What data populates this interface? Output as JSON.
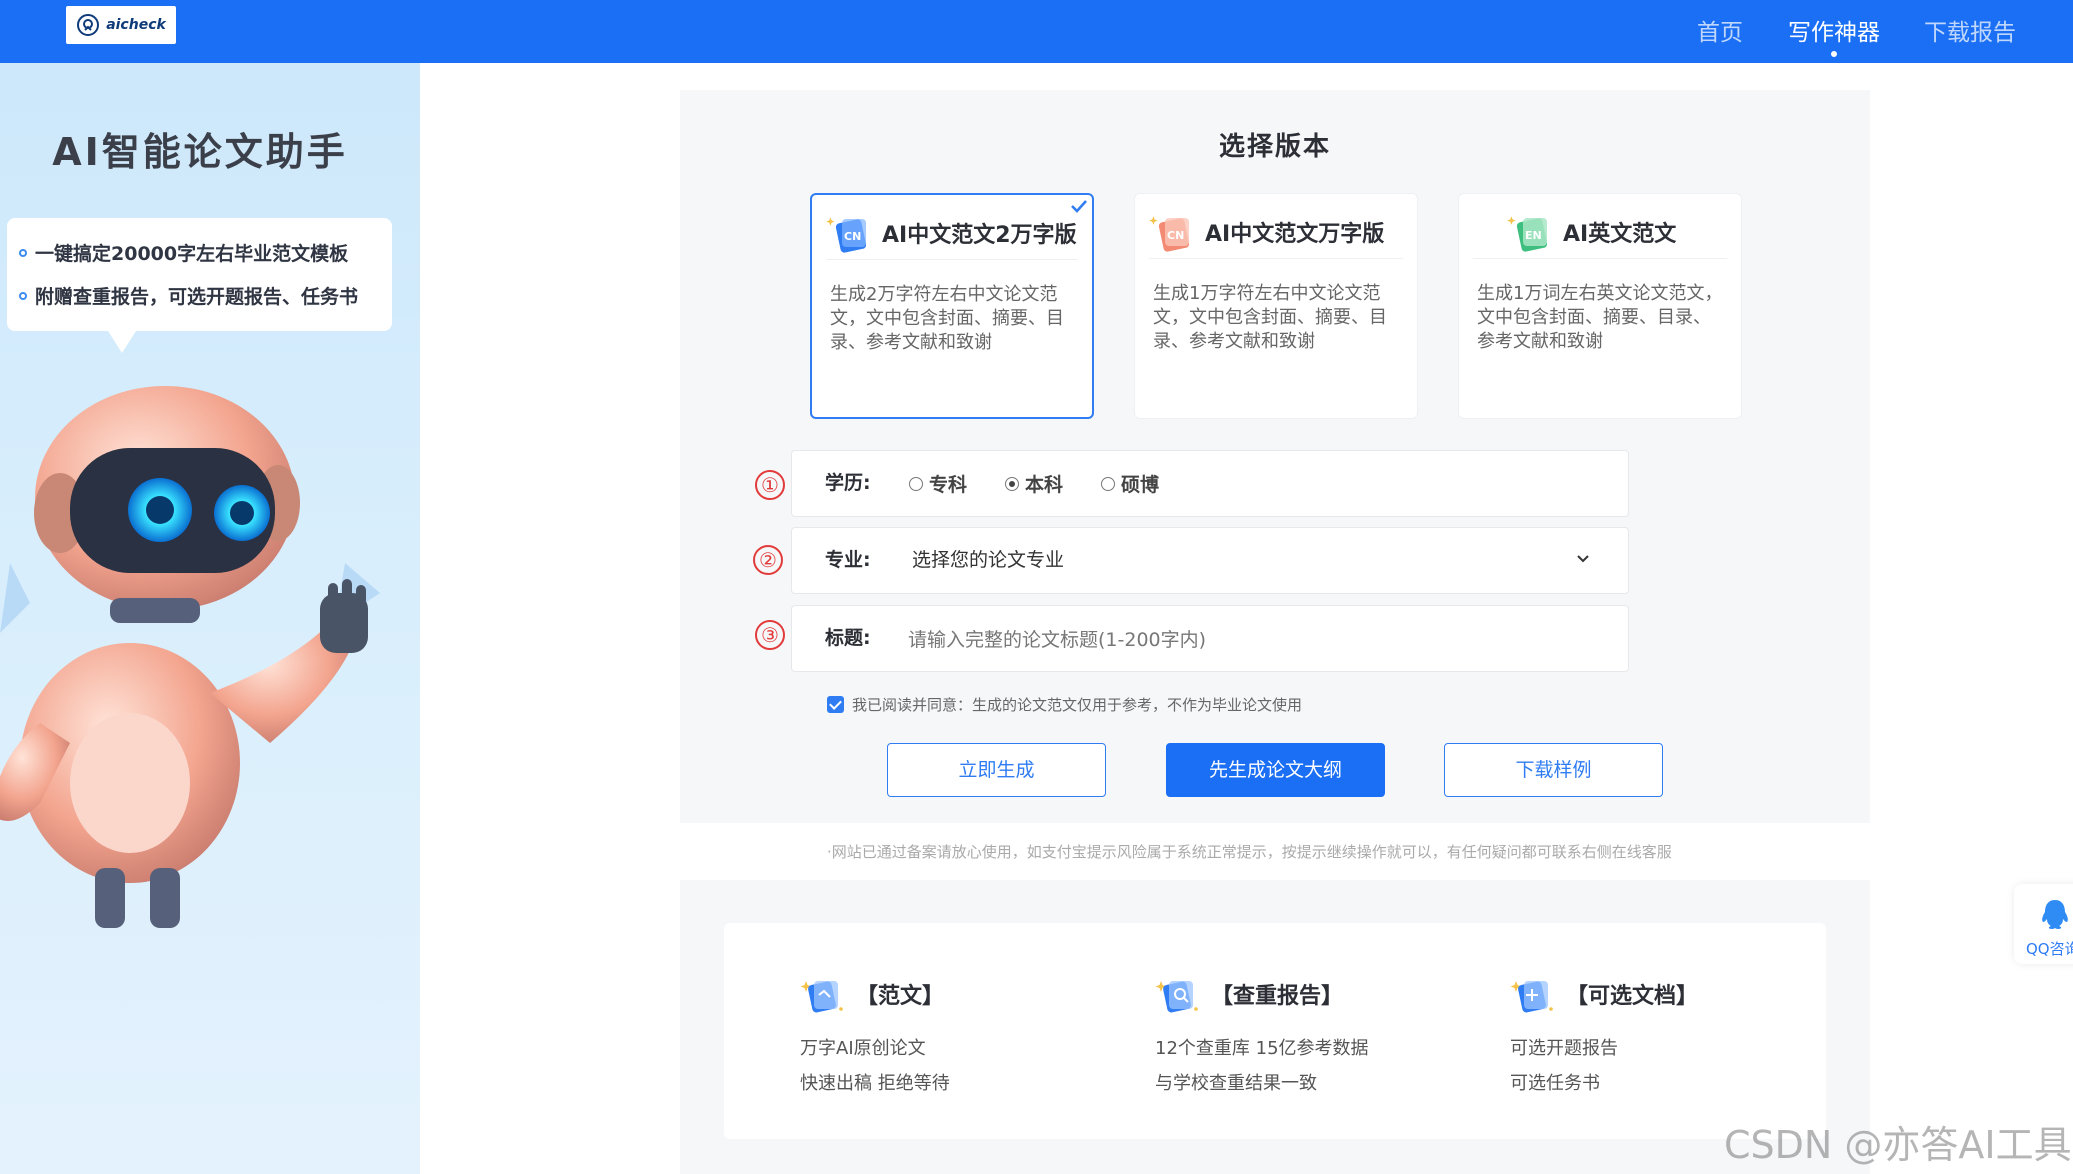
{
  "header": {
    "logo_text": "aicheck",
    "nav": [
      {
        "label": "首页",
        "active": false
      },
      {
        "label": "写作神器",
        "active": true
      },
      {
        "label": "下载报告",
        "active": false
      }
    ],
    "bar_color": "#1a6ff5"
  },
  "left_panel": {
    "title": "AI智能论文助手",
    "bullets": [
      "一键搞定20000字左右毕业范文模板",
      "附赠查重报告，可选开题报告、任务书"
    ]
  },
  "main": {
    "section_title": "选择版本",
    "versions": [
      {
        "name": "AI中文范文2万字版",
        "badge": "CN",
        "desc": "生成2万字符左右中文论文范文，文中包含封面、摘要、目录、参考文献和致谢",
        "selected": true
      },
      {
        "name": "AI中文范文万字版",
        "badge": "CN",
        "desc": "生成1万字符左右中文论文范文，文中包含封面、摘要、目录、参考文献和致谢",
        "selected": false
      },
      {
        "name": "AI英文范文",
        "badge": "EN",
        "desc": "生成1万词左右英文论文范文，文中包含封面、摘要、目录、参考文献和致谢",
        "selected": false
      }
    ],
    "steps": [
      "①",
      "②",
      "③"
    ],
    "education": {
      "label": "学历:",
      "options": [
        {
          "label": "专科",
          "checked": false
        },
        {
          "label": "本科",
          "checked": true
        },
        {
          "label": "硕博",
          "checked": false
        }
      ]
    },
    "major": {
      "label": "专业:",
      "placeholder": "选择您的论文专业"
    },
    "title_field": {
      "label": "标题:",
      "placeholder": "请输入完整的论文标题(1-200字内)",
      "value": ""
    },
    "agreement": {
      "text": "我已阅读并同意：生成的论文范文仅用于参考，不作为毕业论文使用",
      "checked": true
    },
    "buttons": {
      "generate": "立即生成",
      "outline": "先生成论文大纲",
      "sample": "下载样例"
    },
    "notice": "·网站已通过备案请放心使用，如支付宝提示风险属于系统正常提示，按提示继续操作就可以，有任何疑问都可联系右侧在线客服"
  },
  "features": [
    {
      "title": "【范文】",
      "icon": "document-icon",
      "lines": [
        "万字AI原创论文",
        "快速出稿 拒绝等待"
      ]
    },
    {
      "title": "【查重报告】",
      "icon": "search-doc-icon",
      "lines": [
        "12个查重库 15亿参考数据",
        "与学校查重结果一致"
      ]
    },
    {
      "title": "【可选文档】",
      "icon": "edit-doc-icon",
      "lines": [
        "可选开题报告",
        "可选任务书"
      ]
    }
  ],
  "float": {
    "qq_label": "QQ咨询"
  },
  "watermark": "CSDN @亦答AI工具"
}
